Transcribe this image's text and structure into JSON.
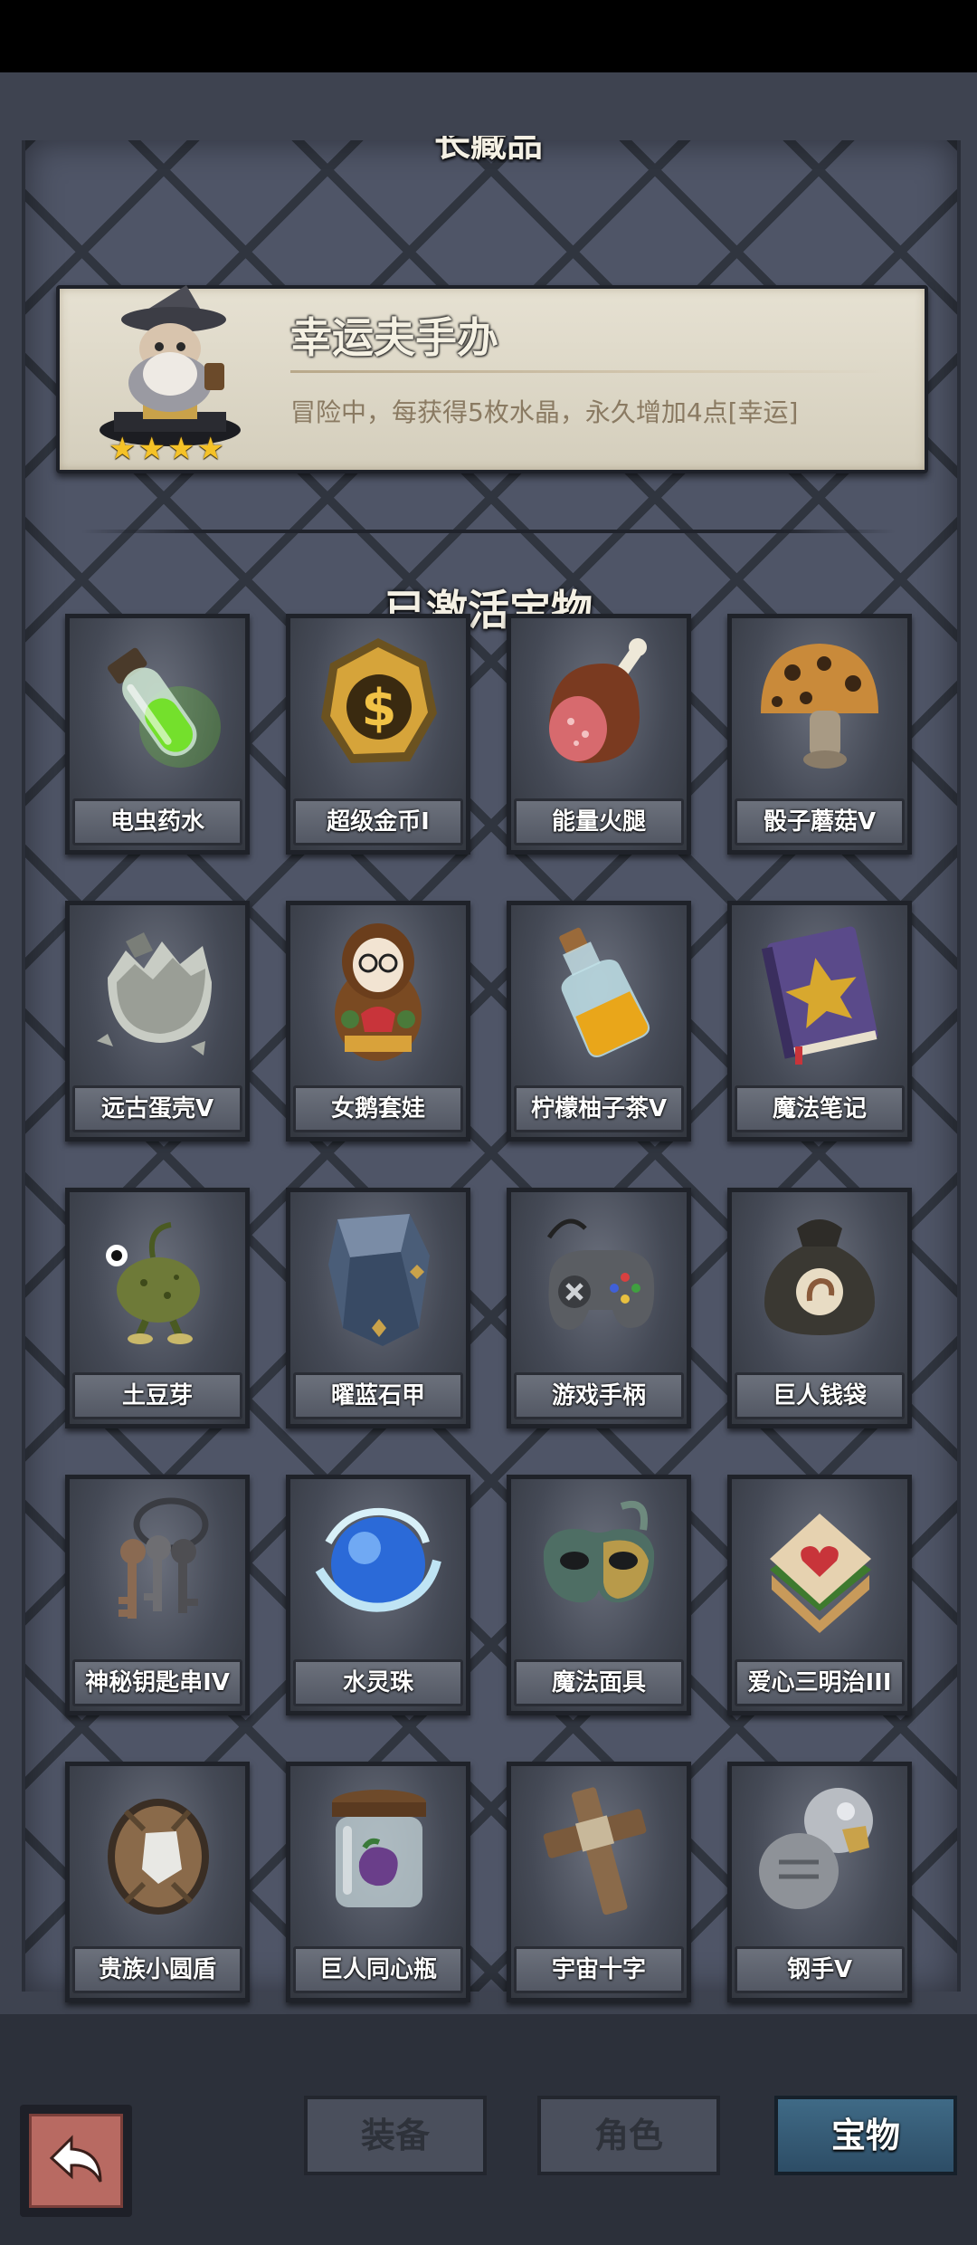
{
  "header": {
    "partial_title": "长藏品"
  },
  "featured": {
    "name": "幸运夫手办",
    "description": "冒险中，每获得5枚水晶，永久增加4点[幸运]",
    "stars": [
      "★",
      "★",
      "★",
      "★"
    ]
  },
  "section": {
    "title": "已激活宝物"
  },
  "treasures": [
    {
      "label": "电虫药水",
      "icon": "green-potion-icon"
    },
    {
      "label": "超级金币I",
      "icon": "gold-coin-icon"
    },
    {
      "label": "能量火腿",
      "icon": "ham-icon"
    },
    {
      "label": "骰子蘑菇V",
      "icon": "dice-mushroom-icon"
    },
    {
      "label": "远古蛋壳V",
      "icon": "egg-shell-icon"
    },
    {
      "label": "女鹅套娃",
      "icon": "nesting-doll-icon"
    },
    {
      "label": "柠檬柚子茶V",
      "icon": "tea-bottle-icon"
    },
    {
      "label": "魔法笔记",
      "icon": "spellbook-icon"
    },
    {
      "label": "土豆芽",
      "icon": "potato-sprout-icon"
    },
    {
      "label": "曜蓝石甲",
      "icon": "armor-icon"
    },
    {
      "label": "游戏手柄",
      "icon": "gamepad-icon"
    },
    {
      "label": "巨人钱袋",
      "icon": "money-bag-icon"
    },
    {
      "label": "神秘钥匙串IV",
      "icon": "keys-icon"
    },
    {
      "label": "水灵珠",
      "icon": "water-orb-icon"
    },
    {
      "label": "魔法面具",
      "icon": "mask-icon"
    },
    {
      "label": "爱心三明治III",
      "icon": "sandwich-icon"
    },
    {
      "label": "贵族小圆盾",
      "icon": "shield-icon"
    },
    {
      "label": "巨人同心瓶",
      "icon": "jar-icon"
    },
    {
      "label": "宇宙十字",
      "icon": "cross-icon"
    },
    {
      "label": "钢手V",
      "icon": "steel-gauntlet-icon"
    }
  ],
  "tabs": [
    {
      "label": "装备",
      "active": false
    },
    {
      "label": "角色",
      "active": false
    },
    {
      "label": "宝物",
      "active": true
    }
  ],
  "colors": {
    "accent_tab": "#3f6a86",
    "back_button": "#b86a62",
    "star": "#f5c227"
  }
}
